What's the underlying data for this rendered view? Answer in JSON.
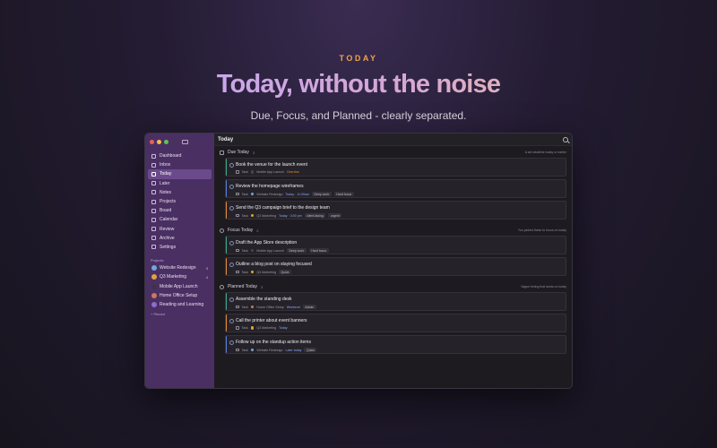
{
  "hero": {
    "eyebrow": "TODAY",
    "headline": "Today, without the noise",
    "subline": "Due, Focus, and Planned - clearly separated."
  },
  "window": {
    "title": "Today"
  },
  "sidebar": {
    "nav": [
      {
        "label": "Dashboard",
        "icon": "dashboard-icon"
      },
      {
        "label": "Inbox",
        "icon": "inbox-icon"
      },
      {
        "label": "Today",
        "icon": "today-icon",
        "active": true
      },
      {
        "label": "Later",
        "icon": "later-icon"
      },
      {
        "label": "Notes",
        "icon": "notes-icon"
      },
      {
        "label": "Projects",
        "icon": "projects-icon"
      },
      {
        "label": "Board",
        "icon": "board-icon"
      },
      {
        "label": "Calendar",
        "icon": "calendar-icon"
      },
      {
        "label": "Review",
        "icon": "review-icon"
      },
      {
        "label": "Archive",
        "icon": "archive-icon"
      },
      {
        "label": "Settings",
        "icon": "settings-icon"
      }
    ],
    "projects_label": "Projects",
    "projects": [
      {
        "label": "Website Redesign",
        "count": "3",
        "color": "#6fa8dc"
      },
      {
        "label": "Q3 Marketing",
        "count": "4",
        "color": "#e0a33c"
      },
      {
        "label": "Mobile App Launch",
        "count": "",
        "color": "#3c3546"
      },
      {
        "label": "Home Office Setup",
        "count": "",
        "color": "#c97a5a"
      },
      {
        "label": "Reading and Learning",
        "count": "",
        "color": "#8f6ad1"
      }
    ],
    "pinned_label": "+ Pinned"
  },
  "sections": {
    "due": {
      "title": "Due Today",
      "count": "3",
      "hint": "A set deadline today or earlier"
    },
    "focus": {
      "title": "Focus Today",
      "count": "2",
      "hint": "You picked these to focus on today"
    },
    "planned": {
      "title": "Planned Today",
      "count": "3",
      "hint": "Vague timing that lands on today"
    }
  },
  "tasks": {
    "due": [
      {
        "title": "Book the venue for the launch event",
        "type": "Task",
        "project": "Mobile App Launch",
        "project_color": "#4a4452",
        "date": "Overdue",
        "date_color": "#e58a3a",
        "tags": [],
        "accent": "#3fa889"
      },
      {
        "title": "Review the homepage wireframes",
        "type": "Task",
        "project": "Website Redesign",
        "project_color": "#6fa8dc",
        "date": "Today · 11:00am",
        "date_color": "#8fa2ff",
        "tags": [
          "Deep work",
          "Hard focus"
        ],
        "accent": "#5b7bd6"
      },
      {
        "title": "Send the Q3 campaign brief to the design team",
        "type": "Task",
        "project": "Q3 Marketing",
        "project_color": "#e0a33c",
        "date": "Today · 3:00 pm",
        "date_color": "#8fa2ff",
        "tags": [
          "client-facing",
          "urgent"
        ],
        "accent": "#e58a3a"
      }
    ],
    "focus": [
      {
        "title": "Draft the App Store description",
        "type": "Task",
        "project": "Mobile App Launch",
        "project_color": "#4a4452",
        "date": "",
        "date_color": "#8fa2ff",
        "tags": [
          "Deep work",
          "Hard focus"
        ],
        "accent": "#3fa889"
      },
      {
        "title": "Outline a blog post on staying focused",
        "type": "Task",
        "project": "Q3 Marketing",
        "project_color": "#e0a33c",
        "date": "",
        "date_color": "#8fa2ff",
        "tags": [
          "Quick"
        ],
        "accent": "#e58a3a"
      }
    ],
    "planned": [
      {
        "title": "Assemble the standing desk",
        "type": "Task",
        "project": "Home Office Setup",
        "project_color": "#c97a5a",
        "date": "Weekend",
        "date_color": "#8fa2ff",
        "tags": [
          "Admin"
        ],
        "accent": "#3fa889"
      },
      {
        "title": "Call the printer about event banners",
        "type": "Task",
        "project": "Q3 Marketing",
        "project_color": "#e0a33c",
        "date": "Today",
        "date_color": "#8fa2ff",
        "tags": [],
        "accent": "#e58a3a"
      },
      {
        "title": "Follow up on the standup action items",
        "type": "Task",
        "project": "Website Redesign",
        "project_color": "#6fa8dc",
        "date": "Later today",
        "date_color": "#8fa2ff",
        "tags": [
          "Quick"
        ],
        "accent": "#5b7bd6"
      }
    ]
  }
}
